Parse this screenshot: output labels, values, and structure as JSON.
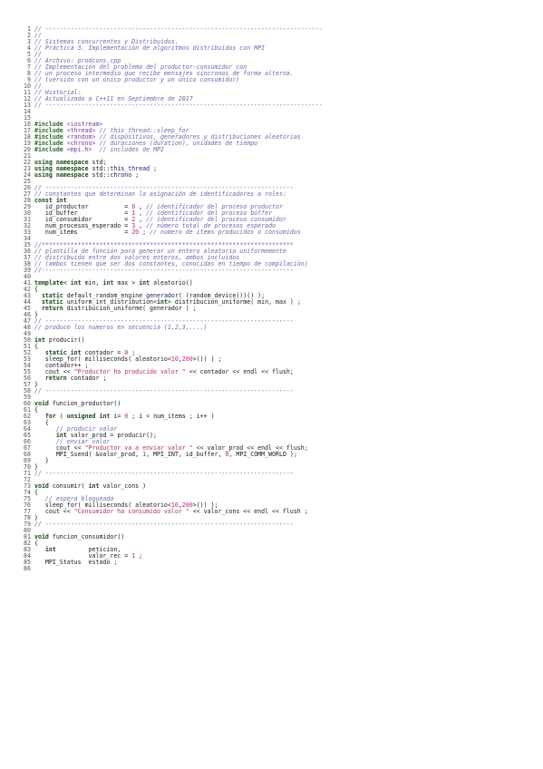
{
  "listing": {
    "lines": [
      [
        [
          "c",
          "// -----------------------------------------------------------------------------"
        ]
      ],
      [
        [
          "c",
          "//"
        ]
      ],
      [
        [
          "c",
          "// Sistemas concurrentes y Distribuidos."
        ]
      ],
      [
        [
          "c",
          "// Práctica 3. Implementación de algoritmos distribuidos con MPI"
        ]
      ],
      [
        [
          "c",
          "//"
        ]
      ],
      [
        [
          "c",
          "// Archivo: prodcons.cpp"
        ]
      ],
      [
        [
          "c",
          "// Implementación del problema del productor-consumidor con"
        ]
      ],
      [
        [
          "c",
          "// un proceso intermedio que recibe mensajes síncronos de forma alterna."
        ]
      ],
      [
        [
          "c",
          "// (versión con un único productor y un único consumidor)"
        ]
      ],
      [
        [
          "c",
          "//"
        ]
      ],
      [
        [
          "c",
          "// Historial:"
        ]
      ],
      [
        [
          "c",
          "// Actualizado a C++11 en Septiembre de 2017"
        ]
      ],
      [
        [
          "c",
          "// -----------------------------------------------------------------------------"
        ]
      ],
      [],
      [],
      [
        [
          "p",
          "#include "
        ],
        [
          "i",
          "<iostream>"
        ]
      ],
      [
        [
          "p",
          "#include "
        ],
        [
          "i",
          "<thread>"
        ],
        [
          "c",
          " // this_thread::sleep_for"
        ]
      ],
      [
        [
          "p",
          "#include "
        ],
        [
          "i",
          "<random>"
        ],
        [
          "c",
          " // dispositivos, generadores y distribuciones aleatorias"
        ]
      ],
      [
        [
          "p",
          "#include "
        ],
        [
          "i",
          "<chrono>"
        ],
        [
          "c",
          " // duraciones (duration), unidades de tiempo"
        ]
      ],
      [
        [
          "p",
          "#include "
        ],
        [
          "i",
          "<mpi.h>"
        ],
        [
          "c",
          "  // includes de MPI"
        ]
      ],
      [],
      [
        [
          "k",
          "using namespace "
        ],
        [
          "plain",
          "std;"
        ]
      ],
      [
        [
          "k",
          "using namespace "
        ],
        [
          "plain",
          "std::"
        ],
        [
          "f",
          "this_thread"
        ],
        [
          "plain",
          " ;"
        ]
      ],
      [
        [
          "k",
          "using namespace "
        ],
        [
          "plain",
          "std::"
        ],
        [
          "f",
          "chrono"
        ],
        [
          "plain",
          " ;"
        ]
      ],
      [],
      [
        [
          "c",
          "// ---------------------------------------------------------------------"
        ]
      ],
      [
        [
          "c",
          "// constantes que determinan la asignación de identificadores a roles:"
        ]
      ],
      [
        [
          "k",
          "const int"
        ]
      ],
      [
        [
          "plain",
          "   id_productor          = "
        ],
        [
          "n",
          "0"
        ],
        [
          "plain",
          " , "
        ],
        [
          "c",
          "// identificador del proceso productor"
        ]
      ],
      [
        [
          "plain",
          "   id_buffer             = "
        ],
        [
          "n",
          "1"
        ],
        [
          "plain",
          " , "
        ],
        [
          "c",
          "// identificador del proceso búffer"
        ]
      ],
      [
        [
          "plain",
          "   id_consumidor         = "
        ],
        [
          "n",
          "2"
        ],
        [
          "plain",
          " , "
        ],
        [
          "c",
          "// identificador del proceso consumidor"
        ]
      ],
      [
        [
          "plain",
          "   num_procesos_esperado = "
        ],
        [
          "n",
          "3"
        ],
        [
          "plain",
          " , "
        ],
        [
          "c",
          "// número total de procesos esperado"
        ]
      ],
      [
        [
          "plain",
          "   num_items             = "
        ],
        [
          "n",
          "20"
        ],
        [
          "plain",
          " ; "
        ],
        [
          "c",
          "// numero de items producidos o consumidos"
        ]
      ],
      [],
      [
        [
          "c",
          "//**********************************************************************"
        ]
      ],
      [
        [
          "c",
          "// plantilla de función para generar un entero aleatorio uniformemente"
        ]
      ],
      [
        [
          "c",
          "// distribuido entre dos valores enteros, ambos incluidos"
        ]
      ],
      [
        [
          "c",
          "// (ambos tienen que ser dos constantes, conocidas en tiempo de compilación)"
        ]
      ],
      [
        [
          "c",
          "//----------------------------------------------------------------------"
        ]
      ],
      [],
      [
        [
          "k",
          "template"
        ],
        [
          "plain",
          "< "
        ],
        [
          "k",
          "int"
        ],
        [
          "plain",
          " min, "
        ],
        [
          "k",
          "int"
        ],
        [
          "plain",
          " max > "
        ],
        [
          "k",
          "int"
        ],
        [
          "plain",
          " aleatorio()"
        ]
      ],
      [
        [
          "plain",
          "{"
        ]
      ],
      [
        [
          "plain",
          "  "
        ],
        [
          "k",
          "static"
        ],
        [
          "plain",
          " default_random_engine "
        ],
        [
          "f",
          "generador"
        ],
        [
          "plain",
          "( (random_device())() );"
        ]
      ],
      [
        [
          "plain",
          "  "
        ],
        [
          "k",
          "static"
        ],
        [
          "plain",
          " uniform_int_distribution<"
        ],
        [
          "k",
          "int"
        ],
        [
          "plain",
          "> distribucion_uniforme( min, max ) ;"
        ]
      ],
      [
        [
          "plain",
          "  "
        ],
        [
          "k",
          "return"
        ],
        [
          "plain",
          " distribucion_uniforme( generador ) ;"
        ]
      ],
      [
        [
          "plain",
          "}"
        ]
      ],
      [
        [
          "c",
          "// ---------------------------------------------------------------------"
        ]
      ],
      [
        [
          "c",
          "// produce los numeros en secuencia (1,2,3,....)"
        ]
      ],
      [],
      [
        [
          "k",
          "int"
        ],
        [
          "plain",
          " producir()"
        ]
      ],
      [
        [
          "plain",
          "{"
        ]
      ],
      [
        [
          "plain",
          "   "
        ],
        [
          "k",
          "static int"
        ],
        [
          "plain",
          " contador = "
        ],
        [
          "n",
          "0"
        ],
        [
          "plain",
          " ;"
        ]
      ],
      [
        [
          "plain",
          "   sleep_for( milliseconds( aleatorio<"
        ],
        [
          "n",
          "10"
        ],
        [
          "plain",
          ","
        ],
        [
          "n",
          "200"
        ],
        [
          "plain",
          ">()) ) ;"
        ]
      ],
      [
        [
          "plain",
          "   contador++ ;"
        ]
      ],
      [
        [
          "plain",
          "   cout << "
        ],
        [
          "s",
          "\"Productor ha producido valor \""
        ],
        [
          "plain",
          " << contador << endl << flush;"
        ]
      ],
      [
        [
          "plain",
          "   "
        ],
        [
          "k",
          "return"
        ],
        [
          "plain",
          " contador ;"
        ]
      ],
      [
        [
          "plain",
          "}"
        ]
      ],
      [
        [
          "c",
          "// ---------------------------------------------------------------------"
        ]
      ],
      [],
      [
        [
          "k",
          "void"
        ],
        [
          "plain",
          " funcion_productor()"
        ]
      ],
      [
        [
          "plain",
          "{"
        ]
      ],
      [
        [
          "plain",
          "   "
        ],
        [
          "k",
          "for"
        ],
        [
          "plain",
          " ( "
        ],
        [
          "k",
          "unsigned int"
        ],
        [
          "plain",
          " i= "
        ],
        [
          "n",
          "0"
        ],
        [
          "plain",
          " ; i < num_items ; i++ )"
        ]
      ],
      [
        [
          "plain",
          "   {"
        ]
      ],
      [
        [
          "plain",
          "      "
        ],
        [
          "c",
          "// producir valor"
        ]
      ],
      [
        [
          "plain",
          "      "
        ],
        [
          "k",
          "int"
        ],
        [
          "plain",
          " valor_prod = producir();"
        ]
      ],
      [
        [
          "plain",
          "      "
        ],
        [
          "c",
          "// enviar valor"
        ]
      ],
      [
        [
          "plain",
          "      cout << "
        ],
        [
          "s",
          "\"Productor va a enviar valor \""
        ],
        [
          "plain",
          " << valor_prod << endl << flush;"
        ]
      ],
      [
        [
          "plain",
          "      MPI_Ssend( &valor_prod, "
        ],
        [
          "n",
          "1"
        ],
        [
          "plain",
          ", MPI_INT, id_buffer, "
        ],
        [
          "n",
          "0"
        ],
        [
          "plain",
          ", MPI_COMM_WORLD );"
        ]
      ],
      [
        [
          "plain",
          "   }"
        ]
      ],
      [
        [
          "plain",
          "}"
        ]
      ],
      [
        [
          "c",
          "// ---------------------------------------------------------------------"
        ]
      ],
      [],
      [
        [
          "k",
          "void"
        ],
        [
          "plain",
          " consumir( "
        ],
        [
          "k",
          "int"
        ],
        [
          "plain",
          " valor_cons )"
        ]
      ],
      [
        [
          "plain",
          "{"
        ]
      ],
      [
        [
          "plain",
          "   "
        ],
        [
          "c",
          "// espera bloqueada"
        ]
      ],
      [
        [
          "plain",
          "   sleep_for( milliseconds( aleatorio<"
        ],
        [
          "n",
          "10"
        ],
        [
          "plain",
          ","
        ],
        [
          "n",
          "200"
        ],
        [
          "plain",
          ">()) );"
        ]
      ],
      [
        [
          "plain",
          "   cout << "
        ],
        [
          "s",
          "\"Consumidor ha consumido valor \""
        ],
        [
          "plain",
          " << valor_cons << endl << flush ;"
        ]
      ],
      [
        [
          "plain",
          "}"
        ]
      ],
      [
        [
          "c",
          "// ---------------------------------------------------------------------"
        ]
      ],
      [],
      [
        [
          "k",
          "void"
        ],
        [
          "plain",
          " funcion_consumidor()"
        ]
      ],
      [
        [
          "plain",
          "{"
        ]
      ],
      [
        [
          "plain",
          "   "
        ],
        [
          "k",
          "int"
        ],
        [
          "plain",
          "         peticion,"
        ]
      ],
      [
        [
          "plain",
          "               valor_rec = "
        ],
        [
          "n",
          "1"
        ],
        [
          "plain",
          " ;"
        ]
      ],
      [
        [
          "plain",
          "   MPI_Status  estado ;"
        ]
      ],
      []
    ]
  }
}
